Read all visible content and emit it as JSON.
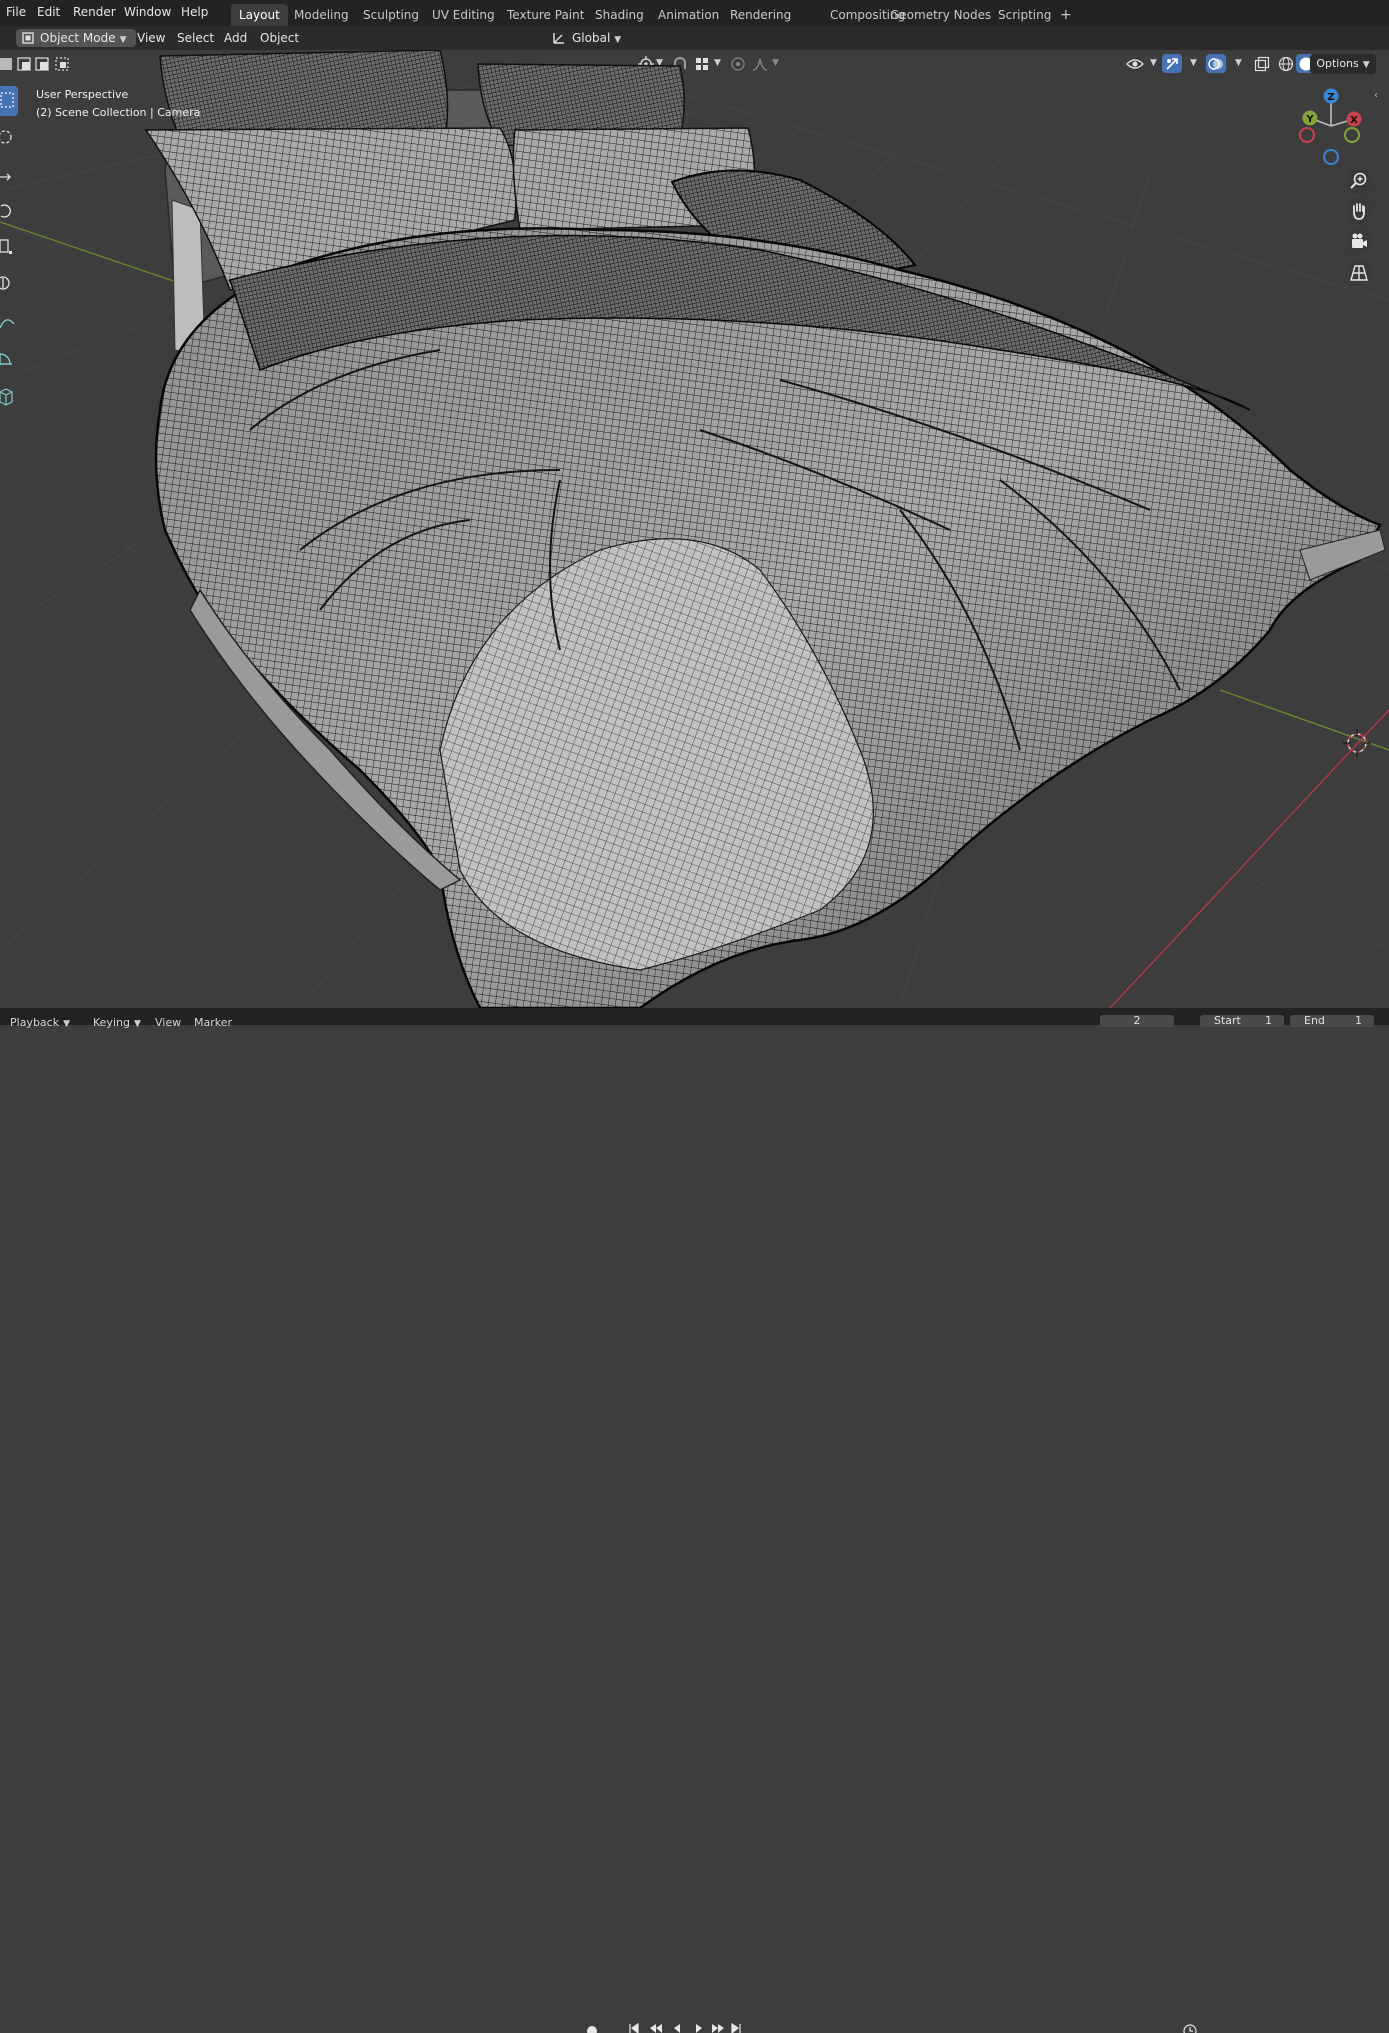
{
  "menu": [
    "File",
    "Edit",
    "Render",
    "Window",
    "Help"
  ],
  "workspaces": [
    "Layout",
    "Modeling",
    "Sculpting",
    "UV Editing",
    "Texture Paint",
    "Shading",
    "Animation",
    "Rendering",
    "Compositing",
    "Geometry Nodes",
    "Scripting"
  ],
  "active_workspace": "Layout",
  "add_tab_symbol": "+",
  "header": {
    "mode": "Object Mode",
    "view": "View",
    "select": "Select",
    "add": "Add",
    "object": "Object",
    "transform": "Global"
  },
  "options_label": "Options",
  "viewport": {
    "line1": "User Perspective",
    "line2": "(2) Scene Collection | Camera"
  },
  "gizmo": {
    "x": "X",
    "y": "Y",
    "z": "Z"
  },
  "timeline": {
    "playback": "Playback",
    "keying": "Keying",
    "view": "View",
    "marker": "Marker",
    "frame": "2",
    "start_label": "Start",
    "start_value": "1",
    "end_label": "End",
    "end_value": "1"
  },
  "colors": {
    "topbar": "#232323",
    "header": "#2b2b2b",
    "viewport_bg": "#3d3d3d",
    "axis_x": "#c8414d",
    "axis_y": "#82a53a",
    "axis_z": "#3a86d6",
    "active_tool": "#4772b3"
  }
}
